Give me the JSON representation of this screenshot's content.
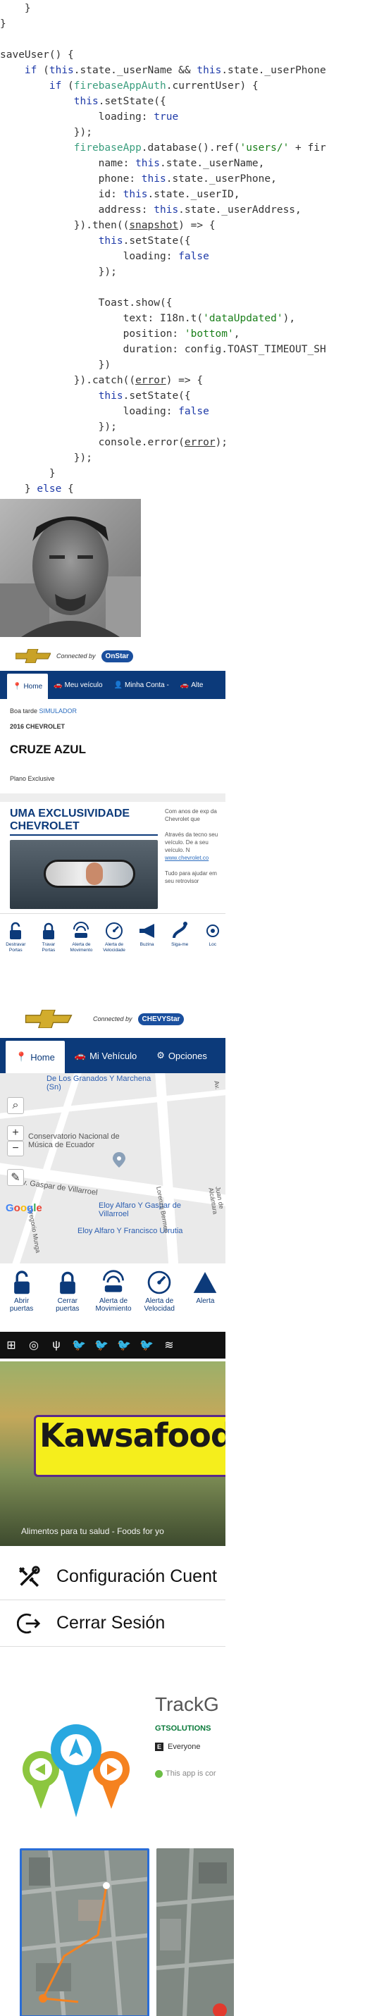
{
  "code": {
    "lines": [
      [
        "    }"
      ],
      [
        "}"
      ],
      [
        ""
      ],
      [
        "saveUser() {"
      ],
      [
        "    if (this.state._userName && this.state._userPhone"
      ],
      [
        "        if (firebaseAppAuth.currentUser) {"
      ],
      [
        "            this.setState({"
      ],
      [
        "                loading: true"
      ],
      [
        "            });"
      ],
      [
        "            firebaseApp.database().ref('users/' + fir"
      ],
      [
        "                name: this.state._userName,"
      ],
      [
        "                phone: this.state._userPhone,"
      ],
      [
        "                id: this.state._userID,"
      ],
      [
        "                address: this.state._userAddress,"
      ],
      [
        "            }).then((snapshot) => {"
      ],
      [
        "                this.setState({"
      ],
      [
        "                    loading: false"
      ],
      [
        "                });"
      ],
      [
        ""
      ],
      [
        "                Toast.show({"
      ],
      [
        "                    text: I18n.t('dataUpdated'),"
      ],
      [
        "                    position: 'bottom',"
      ],
      [
        "                    duration: config.TOAST_TIMEOUT_SH"
      ],
      [
        "                })"
      ],
      [
        "            }).catch((error) => {"
      ],
      [
        "                this.setState({"
      ],
      [
        "                    loading: false"
      ],
      [
        "                });"
      ],
      [
        "                console.error(error);"
      ],
      [
        "            });"
      ],
      [
        "        }"
      ],
      [
        "    } else {"
      ]
    ]
  },
  "onstar": {
    "brand_text": "Connected by",
    "brand_pill": "OnStar",
    "nav": [
      "Home",
      "Meu veículo",
      "Minha Conta -",
      "Alte"
    ],
    "greeting_prefix": "Boa tarde",
    "greeting_name": "SIMULADOR",
    "year_make": "2016 CHEVROLET",
    "model": "CRUZE AZUL",
    "plan": "Plano Exclusive",
    "excl_title": "UMA EXCLUSIVIDADE CHEVROLET",
    "excl_p1": "Com anos de exp da Chevrolet que",
    "excl_p2": "Através da tecno seu veículo. De a seu veículo. N",
    "excl_link": "www.chevrolet.co",
    "excl_p3": "Tudo para ajudar em seu retrovisor",
    "icons": [
      {
        "label": "Destravar Portas",
        "icon": "unlock-icon"
      },
      {
        "label": "Travar Portas",
        "icon": "lock-icon"
      },
      {
        "label": "Alerta de Movimento",
        "icon": "car-alert-icon"
      },
      {
        "label": "Alerta de Velocidade",
        "icon": "speedometer-icon"
      },
      {
        "label": "Buzina",
        "icon": "horn-icon"
      },
      {
        "label": "Siga-me",
        "icon": "follow-icon"
      },
      {
        "label": "Loc",
        "icon": "locate-icon"
      }
    ]
  },
  "chevystar": {
    "brand_text": "Connected by",
    "brand_pill": "CHEVYStar",
    "nav": [
      "Home",
      "Mi Vehículo",
      "Opciones"
    ],
    "map_labels": [
      "De Los Granados Y Marchena (Sn)",
      "Conservatorio Nacional de Música de Ecuador",
      "Av. Gaspar de Villarroel",
      "Eloy Alfaro Y Gaspar de Villarroel",
      "Eloy Alfaro Y Francisco Urrutia",
      "Lorenzo Bermeo",
      "Juan de Alcántara",
      "Gregorio Munga",
      "Av."
    ],
    "google": "Google",
    "icons": [
      {
        "label": "Abrir puertas",
        "icon": "unlock-icon"
      },
      {
        "label": "Cerrar puertas",
        "icon": "lock-icon"
      },
      {
        "label": "Alerta de Movimiento",
        "icon": "car-alert-icon"
      },
      {
        "label": "Alerta de Velocidad",
        "icon": "speedometer-icon"
      },
      {
        "label": "Alerta",
        "icon": "alert-icon"
      }
    ]
  },
  "statusbar": {
    "icons": [
      "plus-box-icon",
      "messenger-icon",
      "usb-icon",
      "twitter-icon",
      "twitter-icon",
      "twitter-icon",
      "twitter-icon",
      "wifi-icon"
    ]
  },
  "kawsafood": {
    "name": "Kawsafood",
    "tagline": "Alimentos para tu salud - Foods for yo"
  },
  "menu": {
    "items": [
      {
        "label": "Configuración Cuent",
        "icon": "tools-icon"
      },
      {
        "label": "Cerrar Sesión",
        "icon": "logout-icon"
      }
    ]
  },
  "trackg": {
    "title": "TrackG",
    "developer": "GTSOLUTIONS",
    "rating_badge": "E",
    "rating": "Everyone",
    "note": "This app is cor"
  }
}
